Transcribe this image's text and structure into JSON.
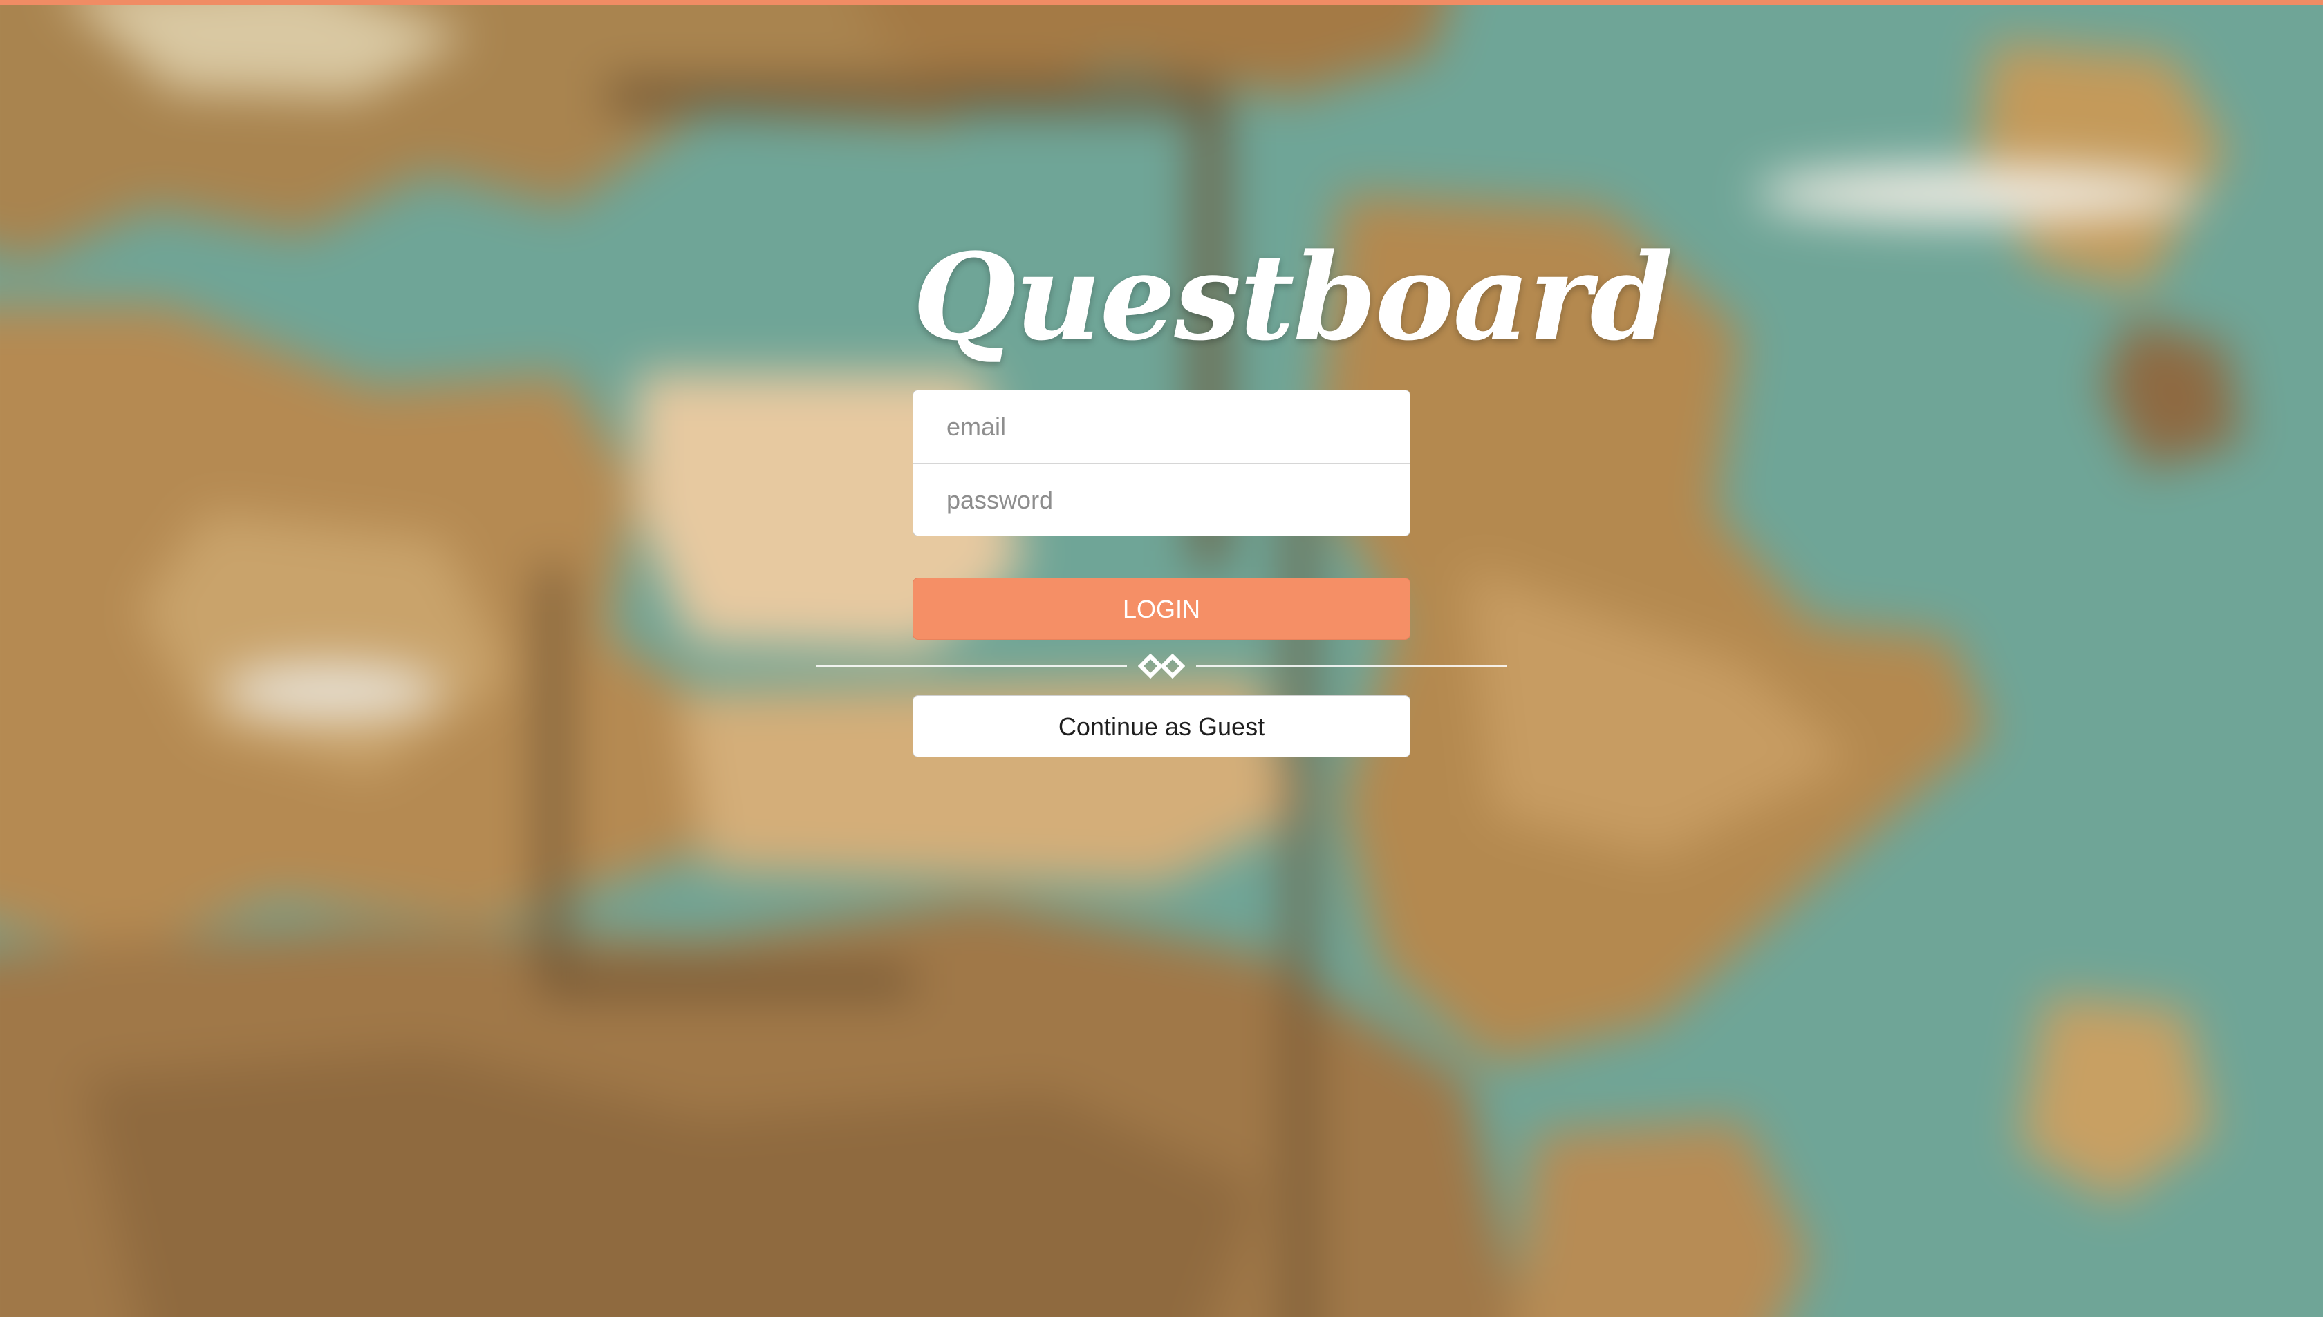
{
  "brand": {
    "title": "Questboard"
  },
  "login_form": {
    "email_placeholder": "email",
    "password_placeholder": "password",
    "login_label": "LOGIN",
    "guest_label": "Continue as Guest"
  },
  "divider": {
    "icon": "diamond-link-icon"
  },
  "colors": {
    "accent": "#f58f66",
    "top_bar": "#f08c64",
    "sea": "#6fa597",
    "land": "#b58a52"
  }
}
